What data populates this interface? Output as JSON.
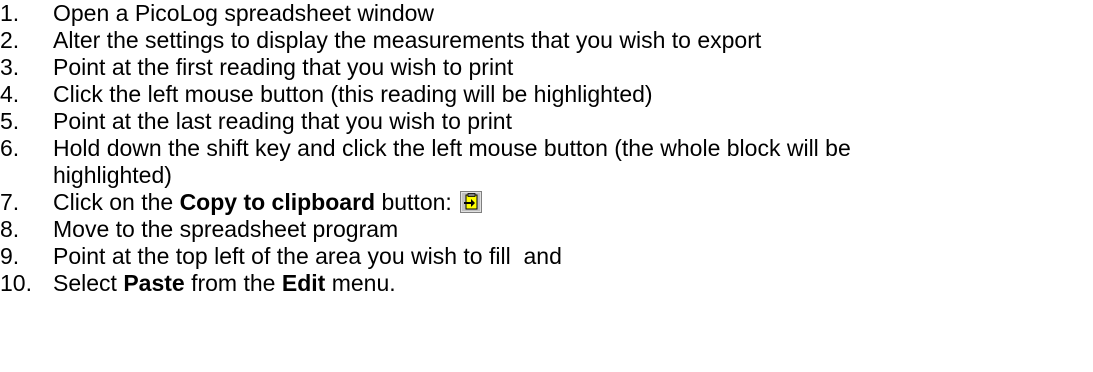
{
  "steps": [
    {
      "num": "1.",
      "text": "Open a PicoLog spreadsheet window"
    },
    {
      "num": "2.",
      "text": "Alter the settings to display the measurements that you wish to export"
    },
    {
      "num": "3.",
      "text": "Point at the first reading that you wish to print"
    },
    {
      "num": "4.",
      "text": "Click the left mouse button (this reading will be highlighted)"
    },
    {
      "num": "5.",
      "text": "Point at the last reading that you wish to print"
    },
    {
      "num": "6.",
      "text": "Hold down the shift key and click the left mouse button (the whole block will be",
      "cont": "highlighted)"
    },
    {
      "num": "7.",
      "pre": "Click on the ",
      "bold": "Copy to clipboard",
      "post": " button:",
      "icon": "copy-to-clipboard-icon"
    },
    {
      "num": "8.",
      "text": "Move to the spreadsheet program"
    },
    {
      "num": "9.",
      "text": "Point at the top left of the area you wish to fill  and"
    },
    {
      "num": "10.",
      "pre": "Select ",
      "bold": "Paste",
      "mid": " from the ",
      "bold2": "Edit",
      "post": " menu."
    }
  ]
}
